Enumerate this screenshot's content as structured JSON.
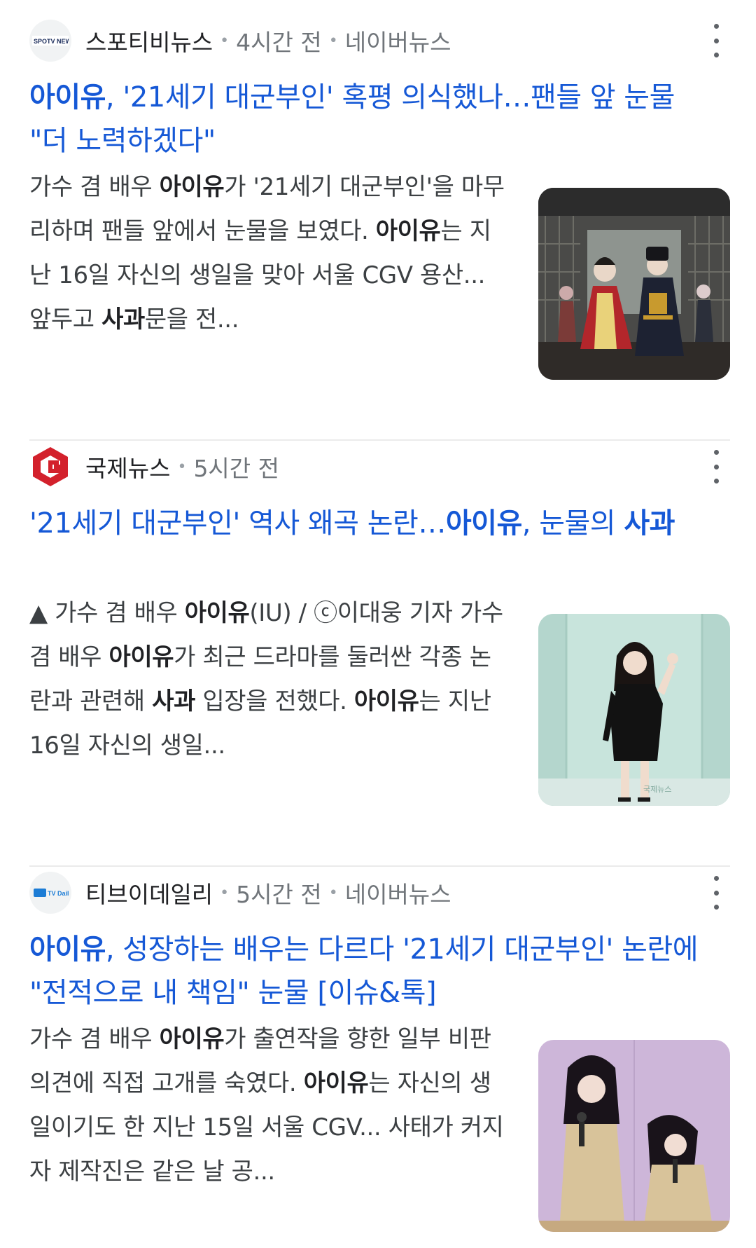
{
  "articles": [
    {
      "source": "스포티비뉴스",
      "logo_text": "SPOTV NEWS",
      "time": "4시간 전",
      "platform": "네이버뉴스",
      "headline": {
        "bold": "아이유",
        "rest": ", '21세기 대군부인' 혹평 의식했나…팬들 앞 눈물 \"더 노력하겠다\""
      },
      "snippet": {
        "p1": "가수 겸 배우 ",
        "b1": "아이유",
        "p2": "가 '21세기 대군부인'을 마무리하며 팬들 앞에서 눈물을 보였다. ",
        "b2": "아이유",
        "p3": "는 지난 16일 자신의 생일을 맞아 서울 CGV 용산... 앞두고 ",
        "b3": "사과",
        "p4": "문을 전..."
      },
      "thumbnail": "drama-still-royal-couple"
    },
    {
      "source": "국제뉴스",
      "logo_text": "G",
      "time": "5시간 전",
      "platform": "",
      "headline": {
        "p1": "'21세기 대군부인' 역사 왜곡 논란…",
        "b1": "아이유",
        "p2": ", 눈물의 ",
        "b2": "사과"
      },
      "snippet": {
        "p1": "▲ 가수 겸 배우 ",
        "b1": "아이유",
        "p2": "(IU) / ⓒ이대웅 기자 가수 겸 배우 ",
        "b2": "아이유",
        "p3": "가 최근 드라마를 둘러싼 각종 논란과 관련해 ",
        "b3": "사과",
        "p4": " 입장을 전했다. ",
        "b4": "아이유",
        "p5": "는 지난 16일 자신의 생일..."
      },
      "thumbnail": "iu-waving-black-dress"
    },
    {
      "source": "티브이데일리",
      "logo_text": "TV Daily",
      "time": "5시간 전",
      "platform": "네이버뉴스",
      "headline": {
        "bold": "아이유",
        "rest": ", 성장하는 배우는 다르다 '21세기 대군부인' 논란에 \"전적으로 내 책임\" 눈물 [이슈&톡]"
      },
      "snippet": {
        "p1": "가수 겸 배우 ",
        "b1": "아이유",
        "p2": "가 출연작을 향한 일부 비판 의견에 직접 고개를 숙였다. ",
        "b2": "아이유",
        "p3": "는 자신의 생일이기도 한 지난 15일 서울 CGV... 사태가 커지자 제작진은 같은 날 공..."
      },
      "thumbnail": "iu-microphone-crying"
    }
  ],
  "colors": {
    "headline": "#1558d6",
    "snippet": "#3c4043",
    "meta": "#70757a",
    "divider": "#ebebeb"
  },
  "icons": {
    "more": "more-vert-icon"
  }
}
